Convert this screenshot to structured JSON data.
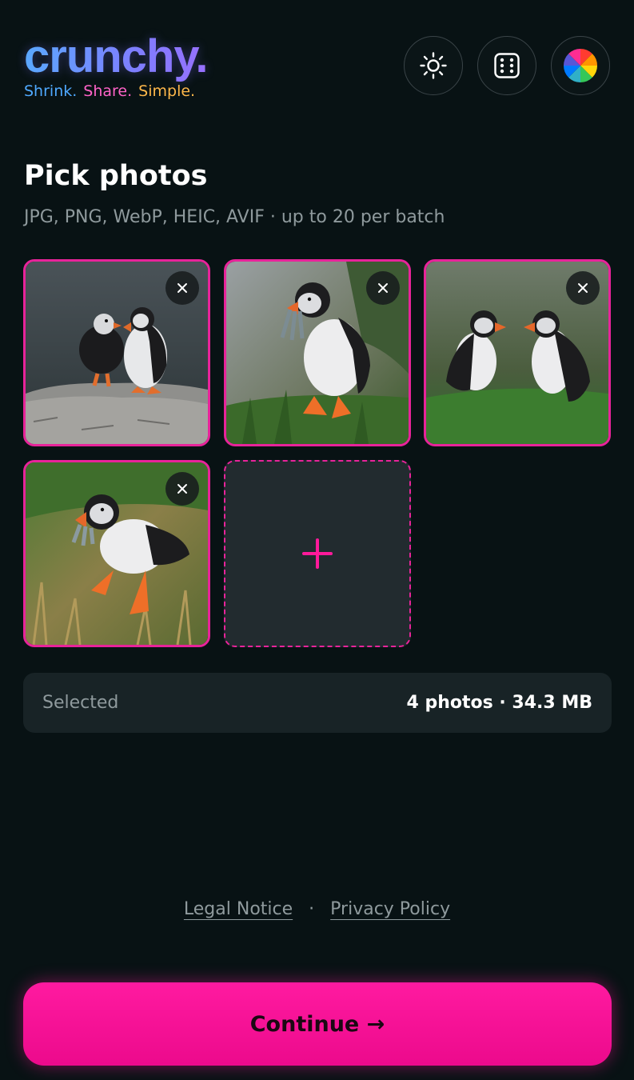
{
  "brand": {
    "name": "crunchy.",
    "tagline": [
      "Shrink.",
      "Share.",
      "Simple."
    ]
  },
  "header": {
    "buttons": [
      {
        "icon": "sun-icon",
        "purpose": "theme toggle"
      },
      {
        "icon": "dice-icon",
        "purpose": "random"
      },
      {
        "icon": "color-wheel-icon",
        "purpose": "accent color"
      }
    ]
  },
  "picker": {
    "title": "Pick photos",
    "subtitle": "JPG, PNG, WebP, HEIC, AVIF · up to 20 per batch",
    "photos": [
      {
        "icon": "puffin-photo-1"
      },
      {
        "icon": "puffin-photo-2"
      },
      {
        "icon": "puffin-photo-3"
      },
      {
        "icon": "puffin-photo-4"
      }
    ],
    "remove_glyph": "×",
    "add_glyph": "+"
  },
  "summary": {
    "label": "Selected",
    "value": "4 photos · 34.3 MB"
  },
  "footer": {
    "legal": "Legal Notice",
    "separator": "·",
    "privacy": "Privacy Policy"
  },
  "cta": {
    "label": "Continue →"
  },
  "colors": {
    "background": "#081214",
    "accent": "#e8239a",
    "cta": "#ff1aa0",
    "muted_text": "#8f9a9d",
    "panel": "#182326",
    "tagline_blue": "#4fa9ff",
    "tagline_pink": "#ff63c8",
    "tagline_orange": "#ffb84a"
  }
}
